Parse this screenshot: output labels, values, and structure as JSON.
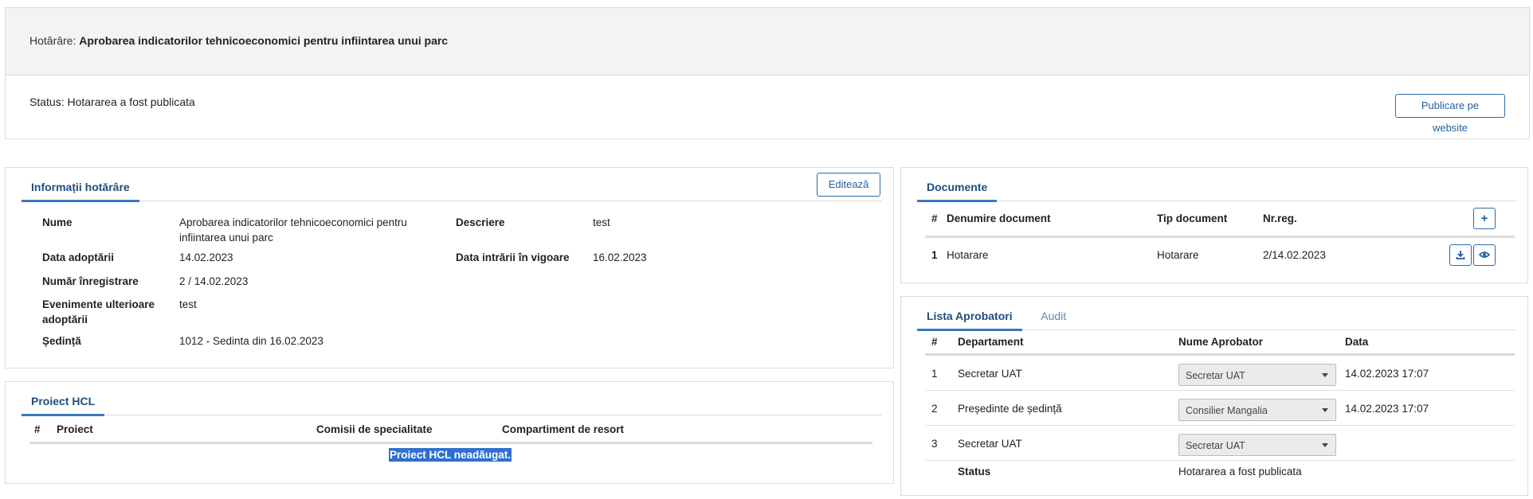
{
  "header": {
    "hotarare_label": "Hotărâre:",
    "hotarare_title": "Aprobarea indicatorilor tehnicoeconomici pentru infiintarea unui parc",
    "status_label": "Status:",
    "status_value": "Hotararea a fost publicata",
    "publish_button": "Publicare pe website"
  },
  "info": {
    "tab": "Informații hotărâre",
    "edit_button": "Editează",
    "fields": {
      "nume_label": "Nume",
      "nume_line1": "Aprobarea indicatorilor tehnicoeconomici pentru",
      "nume_line2": "infiintarea unui parc",
      "descriere_label": "Descriere",
      "descriere_value": "test",
      "data_adoptarii_label": "Data adoptării",
      "data_adoptarii_value": "14.02.2023",
      "data_vigoare_label": "Data intrării în vigoare",
      "data_vigoare_value": "16.02.2023",
      "numar_label": "Număr înregistrare",
      "numar_value": "2 / 14.02.2023",
      "evenimente_label_1": "Evenimente ulterioare",
      "evenimente_label_2": "adoptării",
      "evenimente_value": "test",
      "sedinta_label": "Ședință",
      "sedinta_value": "1012 - Sedinta din 16.02.2023"
    }
  },
  "proiect_hcl": {
    "tab": "Proiect HCL",
    "columns": [
      "#",
      "Proiect",
      "Comisii de specialitate",
      "Compartiment de resort"
    ],
    "empty_message": "Proiect HCL neadăugat."
  },
  "documente": {
    "tab": "Documente",
    "columns": [
      "#",
      "Denumire document",
      "Tip document",
      "Nr.reg."
    ],
    "add_icon": "plus-icon",
    "rows": [
      {
        "nr": "1",
        "denumire": "Hotarare",
        "tip": "Hotarare",
        "nrreg": "2/14.02.2023"
      }
    ]
  },
  "aprobatori": {
    "tabs": [
      "Lista Aprobatori",
      "Audit"
    ],
    "columns": [
      "#",
      "Departament",
      "Nume Aprobator",
      "Data"
    ],
    "rows": [
      {
        "nr": "1",
        "departament": "Secretar UAT",
        "aprobator": "Secretar UAT",
        "data": "14.02.2023 17:07"
      },
      {
        "nr": "2",
        "departament": "Președinte de ședință",
        "aprobator": "Consilier Mangalia",
        "data": "14.02.2023 17:07"
      },
      {
        "nr": "3",
        "departament": "Secretar UAT",
        "aprobator": "Secretar UAT",
        "data": ""
      }
    ],
    "status_label": "Status",
    "status_value": "Hotararea a fost publicata"
  }
}
